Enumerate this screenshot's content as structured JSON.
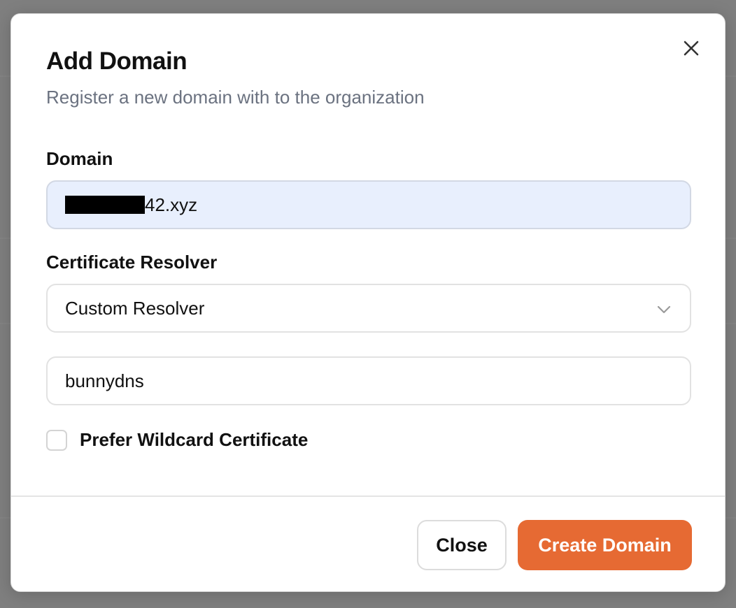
{
  "dialog": {
    "title": "Add Domain",
    "subtitle": "Register a new domain with to the organization",
    "close_icon": "close-icon"
  },
  "domain": {
    "label": "Domain",
    "value_suffix": "42.xyz"
  },
  "resolver": {
    "label": "Certificate Resolver",
    "selected": "Custom Resolver",
    "custom_value": "bunnydns",
    "chevron_icon": "chevron-down-icon"
  },
  "wildcard": {
    "label": "Prefer Wildcard Certificate",
    "checked": false
  },
  "footer": {
    "close_label": "Close",
    "create_label": "Create Domain"
  },
  "colors": {
    "accent": "#e66a33",
    "filled_input_bg": "#e8effd",
    "subtitle": "#6b7280"
  }
}
